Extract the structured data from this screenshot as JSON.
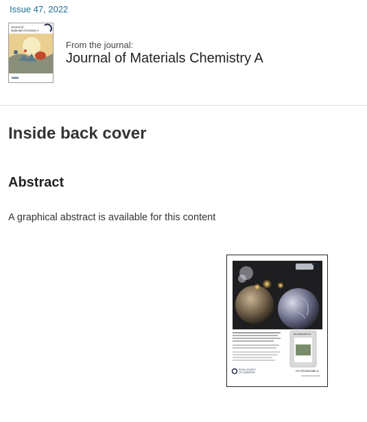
{
  "issue": {
    "label": "Issue 47, 2022"
  },
  "journal": {
    "from_label": "From the journal:",
    "name": "Journal of Materials Chemistry A",
    "thumb_title_line1": "Journal of",
    "thumb_title_line2": "Materials Chemistry A"
  },
  "article": {
    "type_heading": "Inside back cover",
    "abstract_heading": "Abstract",
    "abstract_text": "A graphical abstract is available for this content"
  },
  "graphical_abstract": {
    "featured_label": "As featured in:",
    "rsc_line1": "ROYAL SOCIETY",
    "rsc_line2": "OF CHEMISTRY",
    "journal_url": "rsc.li/materials-a"
  },
  "colors": {
    "link": "#1b6e8f",
    "heading": "#333333",
    "divider": "#dddddd",
    "cover_background": "#1e1d1f"
  }
}
